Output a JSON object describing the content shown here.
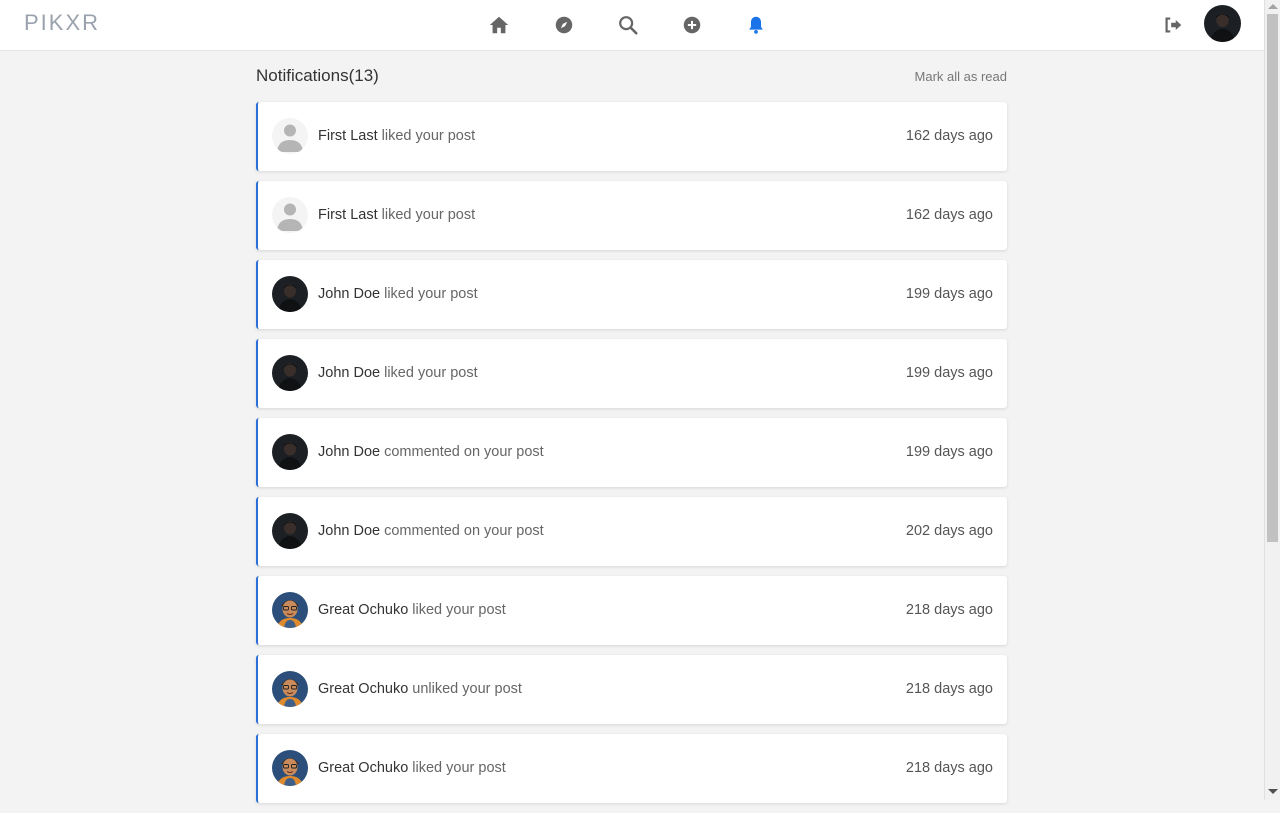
{
  "app": {
    "logo": "PIKXR"
  },
  "nav": {
    "items": [
      {
        "name": "home-icon",
        "active": false
      },
      {
        "name": "explore-compass-icon",
        "active": false
      },
      {
        "name": "search-icon",
        "active": false
      },
      {
        "name": "add-post-icon",
        "active": false
      },
      {
        "name": "notifications-bell-icon",
        "active": true
      }
    ],
    "logout_icon": "logout-icon",
    "accent_color": "#1a73e8"
  },
  "notifications": {
    "title": "Notifications(13)",
    "mark_all_label": "Mark all as read",
    "items": [
      {
        "user": "First Last",
        "action": "liked your post",
        "time": "162 days ago",
        "avatar": "default-avatar"
      },
      {
        "user": "First Last",
        "action": "liked your post",
        "time": "162 days ago",
        "avatar": "default-avatar"
      },
      {
        "user": "John Doe",
        "action": "liked your post",
        "time": "199 days ago",
        "avatar": "dark-avatar"
      },
      {
        "user": "John Doe",
        "action": "liked your post",
        "time": "199 days ago",
        "avatar": "dark-avatar"
      },
      {
        "user": "John Doe",
        "action": "commented on your post",
        "time": "199 days ago",
        "avatar": "dark-avatar"
      },
      {
        "user": "John Doe",
        "action": "commented on your post",
        "time": "202 days ago",
        "avatar": "dark-avatar"
      },
      {
        "user": "Great Ochuko",
        "action": "liked your post",
        "time": "218 days ago",
        "avatar": "cartoon-avatar"
      },
      {
        "user": "Great Ochuko",
        "action": "unliked your post",
        "time": "218 days ago",
        "avatar": "cartoon-avatar"
      },
      {
        "user": "Great Ochuko",
        "action": "liked your post",
        "time": "218 days ago",
        "avatar": "cartoon-avatar"
      }
    ]
  }
}
